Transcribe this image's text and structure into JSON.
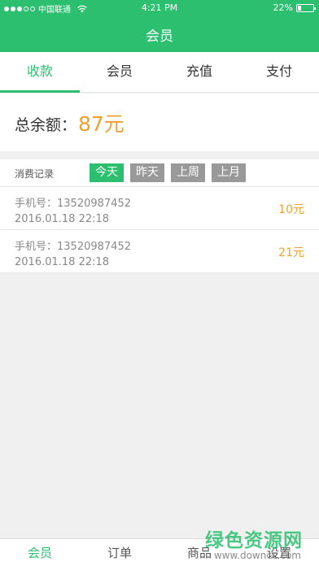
{
  "status_bar": {
    "carrier": "中国联通",
    "time": "4:21 PM",
    "battery_text": "22%",
    "battery_level": 0.22
  },
  "header": {
    "title": "会员"
  },
  "tabs": [
    {
      "label": "收款",
      "active": true
    },
    {
      "label": "会员"
    },
    {
      "label": "充值"
    },
    {
      "label": "支付"
    }
  ],
  "balance": {
    "label": "总余额：",
    "amount": "87元"
  },
  "records": {
    "title": "消费记录",
    "filters": [
      {
        "label": "今天",
        "active": true
      },
      {
        "label": "昨天"
      },
      {
        "label": "上周"
      },
      {
        "label": "上月"
      }
    ],
    "items": [
      {
        "phone": "手机号：13520987452",
        "date": "2016.01.18    22:18",
        "amount": "10元"
      },
      {
        "phone": "手机号：13520987452",
        "date": "2016.01.18    22:18",
        "amount": "21元"
      }
    ]
  },
  "bottom_nav": [
    {
      "label": "会员",
      "active": true
    },
    {
      "label": "订单"
    },
    {
      "label": "商品"
    },
    {
      "label": "设置"
    }
  ],
  "watermark": {
    "text": "绿色资源网",
    "sub": "www.downcc.com"
  },
  "colors": {
    "accent": "#2bbf6f",
    "amount": "#f0a030"
  }
}
